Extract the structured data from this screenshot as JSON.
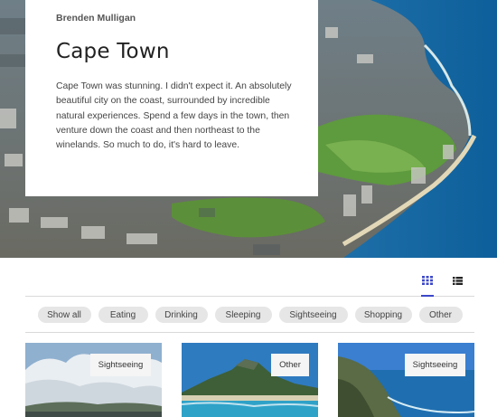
{
  "hero": {
    "author": "Brenden Mulligan",
    "title": "Cape Town",
    "text": "Cape Town was stunning. I didn't expect it. An absolutely beautiful city on the coast, surrounded by incredible natural experiences. Spend a few days in the town, then venture down the coast and then northeast to the winelands. So much to do, it's hard to leave.",
    "image_icon": "aerial-city-coast-photo"
  },
  "view_toggle": {
    "grid_icon": "grid-view-icon",
    "list_icon": "list-view-icon",
    "active": "grid",
    "accent_color": "#3b47c8"
  },
  "filters": [
    "Show all",
    "Eating",
    "Drinking",
    "Sleeping",
    "Sightseeing",
    "Shopping",
    "Other"
  ],
  "cards": [
    {
      "tag": "Sightseeing",
      "image": "clouds-over-hills-photo"
    },
    {
      "tag": "Other",
      "image": "table-mountain-beach-photo"
    },
    {
      "tag": "Sightseeing",
      "image": "coastal-cliffs-photo"
    }
  ]
}
